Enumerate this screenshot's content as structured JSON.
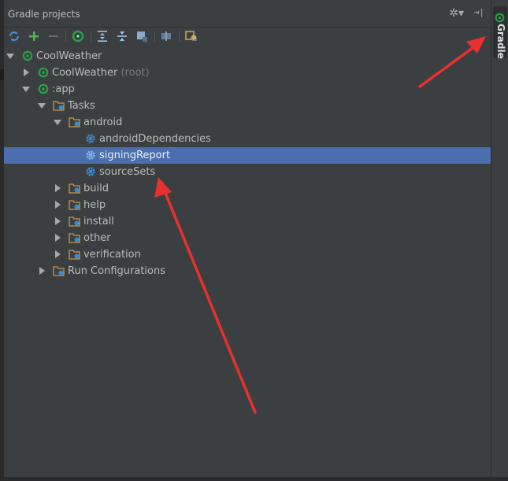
{
  "panel": {
    "title": "Gradle projects",
    "settings_icon": "gear-icon",
    "hide_icon": "pin-hide-icon"
  },
  "toolbar": {
    "buttons": [
      "refresh-icon",
      "add-icon",
      "remove-icon",
      "execute-task-icon",
      "expand-all-icon",
      "collapse-all-icon",
      "offline-mode-icon",
      "toggle-tasks-icon",
      "gradle-settings-icon"
    ]
  },
  "tree": {
    "root": {
      "label": "CoolWeather"
    },
    "coolweather_root": {
      "label": "CoolWeather",
      "hint": "(root)"
    },
    "app": {
      "label": ":app"
    },
    "tasks": {
      "label": "Tasks"
    },
    "android": {
      "label": "android"
    },
    "android_dependencies": {
      "label": "androidDependencies"
    },
    "signing_report": {
      "label": "signingReport"
    },
    "source_sets": {
      "label": "sourceSets"
    },
    "build": {
      "label": "build"
    },
    "help": {
      "label": "help"
    },
    "install": {
      "label": "install"
    },
    "other": {
      "label": "other"
    },
    "verification": {
      "label": "verification"
    },
    "run_configurations": {
      "label": "Run Configurations"
    }
  },
  "sidebar": {
    "gradle_tab": "Gradle"
  },
  "colors": {
    "background": "#3c3f41",
    "selection": "#4b6eaf",
    "annotation_arrow": "#e8312f",
    "gradle_green": "#29a348",
    "task_gear_blue": "#3d8ad1"
  }
}
